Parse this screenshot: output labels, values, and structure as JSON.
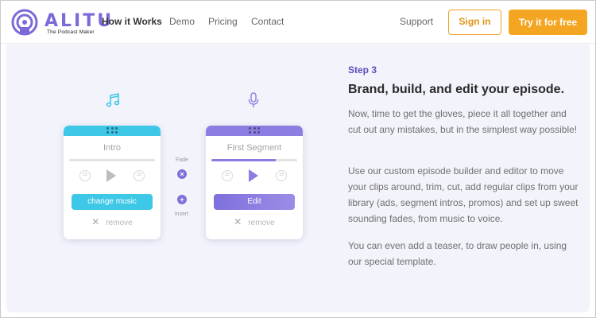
{
  "brand": {
    "name": "ALITU",
    "tagline": "The Podcast Maker"
  },
  "nav": {
    "items": [
      {
        "label": "How it Works",
        "active": true
      },
      {
        "label": "Demo",
        "active": false
      },
      {
        "label": "Pricing",
        "active": false
      },
      {
        "label": "Contact",
        "active": false
      }
    ],
    "support": "Support",
    "sign_in": "Sign in",
    "try_free": "Try it for free"
  },
  "colors": {
    "brand_purple": "#7b6ad8",
    "accent_orange": "#f4a522",
    "cyan": "#3cc8e6",
    "panel_bg": "#f2f3fb"
  },
  "demo": {
    "music_icon": "music-note-icon",
    "mic_icon": "microphone-icon",
    "intro_card": {
      "title": "Intro",
      "button": "change music",
      "remove": "remove",
      "progress": 0
    },
    "segment_card": {
      "title": "First Segment",
      "button": "Edit",
      "remove": "remove",
      "progress": 0.75
    },
    "connector": {
      "fade_label": "Fade",
      "insert_label": "insert"
    }
  },
  "content": {
    "step": "Step 3",
    "headline": "Brand, build, and edit your episode.",
    "paragraph1": "Now, time to get the gloves, piece it all together and cut out any mistakes, but in the simplest way possible!",
    "paragraph2": "Use our custom episode builder and editor to move your clips around, trim, cut,  add regular clips from your library (ads, segment intros, promos) and set up sweet sounding fades, from music to voice.",
    "paragraph3": "You can even add a teaser, to draw people in, using our special template."
  }
}
